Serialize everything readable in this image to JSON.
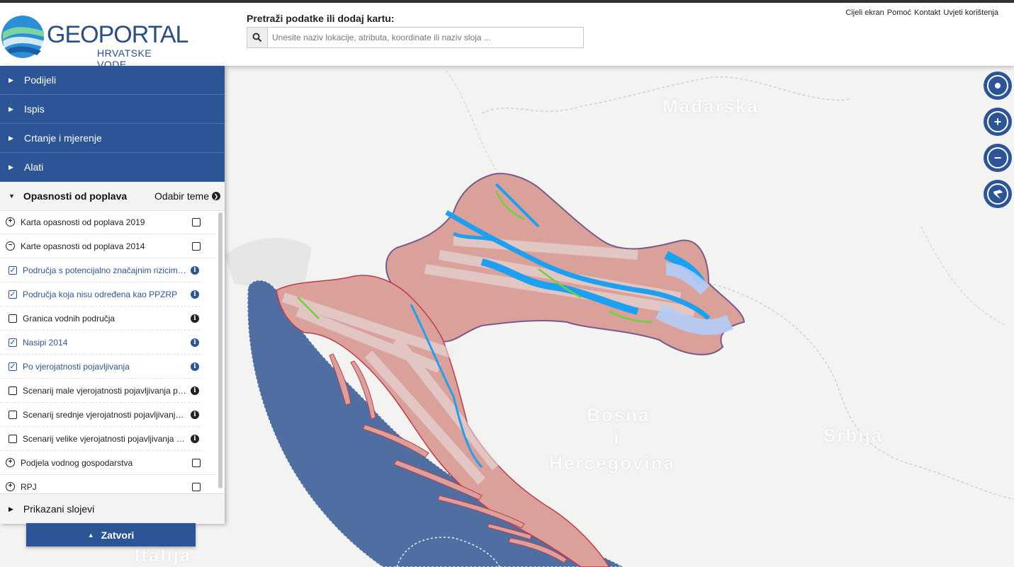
{
  "header": {
    "logo_main": "GEOPORTAL",
    "logo_sub": "HRVATSKE VODE",
    "search_label": "Pretraži podatke ili dodaj kartu:",
    "search_placeholder": "Unesite naziv lokacije, atributa, koordinate ili naziv sloja ...",
    "links": [
      "Cijeli ekran",
      "Pomoć",
      "Kontakt",
      "Uvjeti korištenja"
    ]
  },
  "panel": {
    "menu": [
      "Podijeli",
      "Ispis",
      "Crtanje i mjerenje",
      "Alati"
    ],
    "active_theme": "Opasnosti od poplava",
    "theme_link": "Odabir teme",
    "layers": [
      {
        "type": "group",
        "expand": "+",
        "label": "Karta opasnosti od poplava 2019",
        "checked": false
      },
      {
        "type": "group",
        "expand": "−",
        "label": "Karte opasnosti od poplava 2014",
        "checked": false
      },
      {
        "type": "layer",
        "label": "Područja s potencijalno značajnim rizicima od poplava",
        "checked": true
      },
      {
        "type": "layer",
        "label": "Područja koja nisu određena kao PPZRP",
        "checked": true
      },
      {
        "type": "layer",
        "label": "Granica vodnih područja",
        "checked": false
      },
      {
        "type": "layer",
        "label": "Nasipi 2014",
        "checked": true
      },
      {
        "type": "layer",
        "label": "Po vjerojatnosti pojavljivanja",
        "checked": true
      },
      {
        "type": "layer",
        "label": "Scenarij male vjerojatnosti pojavljivanja poplava",
        "checked": false
      },
      {
        "type": "layer",
        "label": "Scenarij srednje vjerojatnosti pojavljivanja poplava",
        "checked": false
      },
      {
        "type": "layer",
        "label": "Scenarij velike vjerojatnosti pojavljivanja poplava",
        "checked": false
      },
      {
        "type": "group",
        "expand": "+",
        "label": "Podjela vodnog gospodarstva",
        "checked": false
      },
      {
        "type": "group",
        "expand": "+",
        "label": "RPJ",
        "checked": false
      }
    ],
    "shown_layers": "Prikazani slojevi",
    "close_label": "Zatvori"
  },
  "map": {
    "labels": {
      "hungary": "Mađarska",
      "bosnia_1": "Bosna",
      "bosnia_2": "i",
      "bosnia_3": "Hercegovina",
      "serbia": "Srbija",
      "italy": "Italija"
    }
  },
  "colors": {
    "primary": "#2c5597",
    "sea": "#4f6fa3",
    "flood_blue": "#1ea0f0",
    "risk_area": "#d9a19a"
  }
}
